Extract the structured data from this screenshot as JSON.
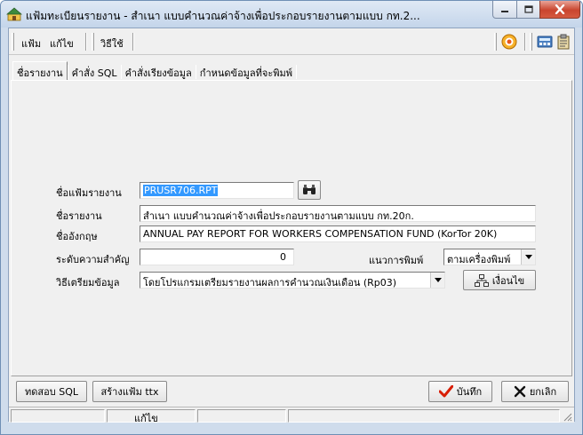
{
  "window": {
    "title": "แฟ้มทะเบียนรายงาน - สำเนา แบบคำนวณค่าจ้างเพื่อประกอบรายงานตามแบบ กท.2..."
  },
  "menu": {
    "file": "แฟ้ม",
    "edit": "แก้ไข",
    "help": "วิธีใช้"
  },
  "tabs": [
    {
      "label": "ชื่อรายงาน",
      "active": true
    },
    {
      "label": "คำสั่ง SQL",
      "active": false
    },
    {
      "label": "คำสั่งเรียงข้อมูล",
      "active": false
    },
    {
      "label": "กำหนดข้อมูลที่จะพิมพ์",
      "active": false
    }
  ],
  "form": {
    "report_file_label": "ชื่อแฟ้มรายงาน",
    "report_file_value": "PRUSR706.RPT",
    "report_name_label": "ชื่อรายงาน",
    "report_name_value": "สำเนา แบบคำนวณค่าจ้างเพื่อประกอบรายงานตามแบบ กท.20ก.",
    "english_name_label": "ชื่ออังกฤษ",
    "english_name_value": "ANNUAL PAY REPORT FOR WORKERS COMPENSATION FUND (KorTor 20K)",
    "priority_label": "ระดับความสำคัญ",
    "priority_value": "0",
    "orientation_label": "แนวการพิมพ์",
    "orientation_value": "ตามเครื่องพิมพ์",
    "prep_method_label": "วิธีเตรียมข้อมูล",
    "prep_method_value": "โดยโปรแกรมเตรียมรายงานผลการคำนวณเงินเดือน (Rp03)",
    "condition_button": "เงื่อนไข"
  },
  "buttons": {
    "test_sql": "ทดสอบ SQL",
    "create_ttx": "สร้างแฟ้ม ttx",
    "save": "บันทึก",
    "cancel": "ยกเลิก"
  },
  "status": {
    "mode": "แก้ไข"
  },
  "colors": {
    "selection": "#3399ff",
    "save_check": "#d81e05",
    "titlebar": "#c4d5ea",
    "close_button": "#c9452f"
  }
}
